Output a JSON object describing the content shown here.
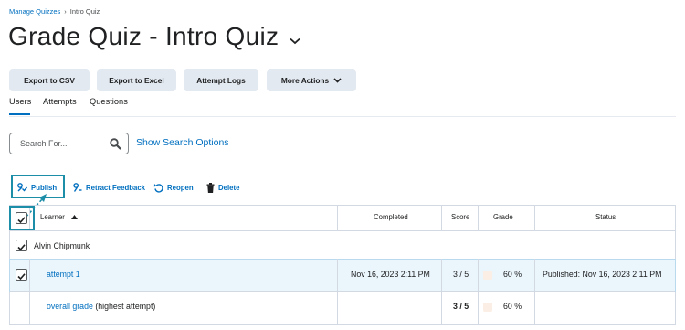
{
  "breadcrumb": {
    "parent": "Manage Quizzes",
    "separator": "›",
    "current": "Intro Quiz"
  },
  "page_title": "Grade Quiz - Intro Quiz",
  "toolbar": {
    "export_csv": "Export to CSV",
    "export_excel": "Export to Excel",
    "attempt_logs": "Attempt Logs",
    "more_actions": "More Actions"
  },
  "tabs": {
    "users": "Users",
    "attempts": "Attempts",
    "questions": "Questions",
    "active": "Users"
  },
  "search": {
    "placeholder": "Search For...",
    "value": "",
    "show_options": "Show Search Options"
  },
  "actions": {
    "publish": "Publish",
    "retract": "Retract Feedback",
    "reopen": "Reopen",
    "delete": "Delete"
  },
  "table": {
    "headers": {
      "learner": "Learner",
      "completed": "Completed",
      "score": "Score",
      "grade": "Grade",
      "status": "Status"
    },
    "user_row": {
      "name": "Alvin Chipmunk",
      "checked": true
    },
    "attempt_row": {
      "label": "attempt 1",
      "completed": "Nov 16, 2023 2:11 PM",
      "score": "3 / 5",
      "grade": "60 %",
      "status": "Published: Nov 16, 2023 2:11 PM",
      "checked": true
    },
    "overall_row": {
      "link": "overall grade",
      "note": "(highest attempt)",
      "score": "3 / 5",
      "grade": "60 %"
    }
  },
  "colors": {
    "link": "#006fbf",
    "button_bg": "#e3e9f1",
    "highlight": "#1d8ea8",
    "selected_row": "#eaf5fc",
    "grade_swatch": "#fbeee4"
  }
}
